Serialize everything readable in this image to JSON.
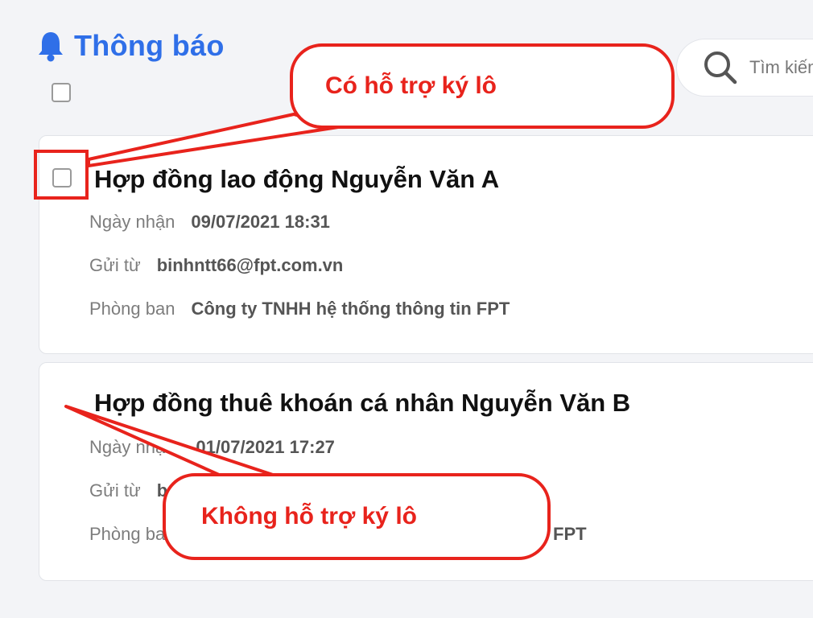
{
  "header": {
    "title": "Thông báo",
    "bell_icon": "bell-icon",
    "accent_color": "#2f6fe8"
  },
  "search": {
    "placeholder": "Tìm kiếm",
    "icon": "search-icon"
  },
  "notifications": [
    {
      "title": "Hợp đồng lao động Nguyễn Văn A",
      "received_label": "Ngày nhận",
      "received_value": "09/07/2021 18:31",
      "from_label": "Gửi từ",
      "from_value": "binhntt66@fpt.com.vn",
      "department_label": "Phòng ban",
      "department_value": "Công ty TNHH hệ thống thông tin FPT",
      "has_checkbox": true
    },
    {
      "title": "Hợp đồng thuê khoán cá nhân Nguyễn Văn B",
      "received_label": "Ngày nhận",
      "received_value": "01/07/2021 17:27",
      "from_label": "Gửi từ",
      "from_value": "b",
      "department_label": "Phòng ban",
      "department_value": "FPT",
      "has_checkbox": false
    }
  ],
  "annotations": {
    "supported": "Có hỗ trợ ký lô",
    "not_supported": "Không hỗ trợ ký lô",
    "color": "#e8231c"
  }
}
